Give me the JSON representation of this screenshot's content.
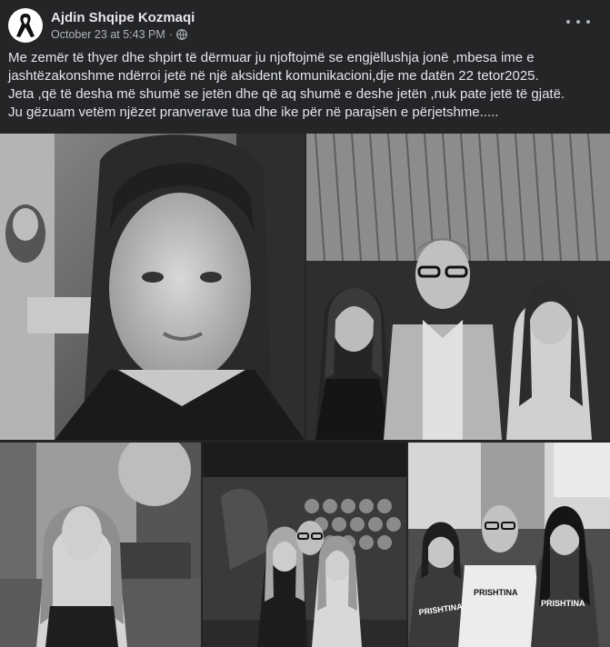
{
  "post": {
    "author": "Ajdin Shqipe Kozmaqi",
    "timestamp": "October 23 at 5:43 PM",
    "separator": "·",
    "audience_icon": "globe-icon",
    "avatar_icon": "black-ribbon-icon",
    "more_icon": "more-options-icon",
    "text_lines": [
      "Me zemër të thyer dhe shpirt të dërmuar ju njoftojmë se engjëllushja jonë ,mbesa ime e",
      "jashtëzakonshme ndërroi jetë në një  aksident komunikacioni,dje me datën 22 tetor2025.",
      "Jeta ,që të desha më shumë se jetën dhe që aq shumë e deshe jetën ,nuk pate jetë të gjatë.",
      "Ju gëzuam vetëm njëzet pranverave tua dhe ike për në parajsën e përjetshme....."
    ]
  },
  "photos": {
    "shirt_text": "PRISHTINA"
  },
  "colors": {
    "background": "#242526",
    "text_primary": "#e4e6eb",
    "text_secondary": "#b0b3b8"
  }
}
